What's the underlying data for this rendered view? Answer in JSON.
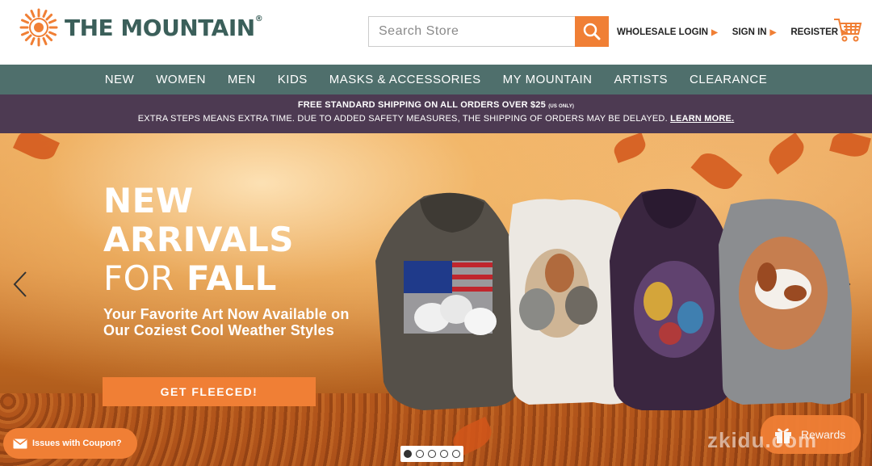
{
  "brand": {
    "name": "THE MOUNTAIN",
    "registered": "®",
    "accent_color": "#f07f35",
    "nav_color": "#4f6f6c",
    "promo_color": "#4d3a52"
  },
  "search": {
    "placeholder": "Search Store",
    "icon": "search-icon"
  },
  "top_links": {
    "wholesale": "WHOLESALE LOGIN",
    "sign_in": "SIGN IN",
    "register": "REGISTER",
    "cart_icon": "cart-icon"
  },
  "nav": {
    "items": [
      "NEW",
      "WOMEN",
      "MEN",
      "KIDS",
      "MASKS & ACCESSORIES",
      "MY MOUNTAIN",
      "ARTISTS",
      "CLEARANCE"
    ]
  },
  "promo": {
    "line1": "FREE STANDARD SHIPPING ON ALL ORDERS OVER $25",
    "line1_note": "(US ONLY)",
    "line2": "EXTRA STEPS MEANS EXTRA TIME. DUE TO ADDED SAFETY MEASURES, THE SHIPPING OF ORDERS MAY BE DELAYED.",
    "learn_more": "LEARN MORE."
  },
  "hero": {
    "line1": "NEW",
    "line2": "ARRIVALS",
    "line3_thin": "FOR",
    "line3_bold": "FALL",
    "subtitle": "Your Favorite Art Now Available on Our Coziest Cool Weather Styles",
    "cta": "GET FLEECED!",
    "slides": 5,
    "active_slide": 1
  },
  "widgets": {
    "coupon": "Issues with Coupon?",
    "rewards": "Rewards",
    "watermark": "zkidu.com"
  }
}
